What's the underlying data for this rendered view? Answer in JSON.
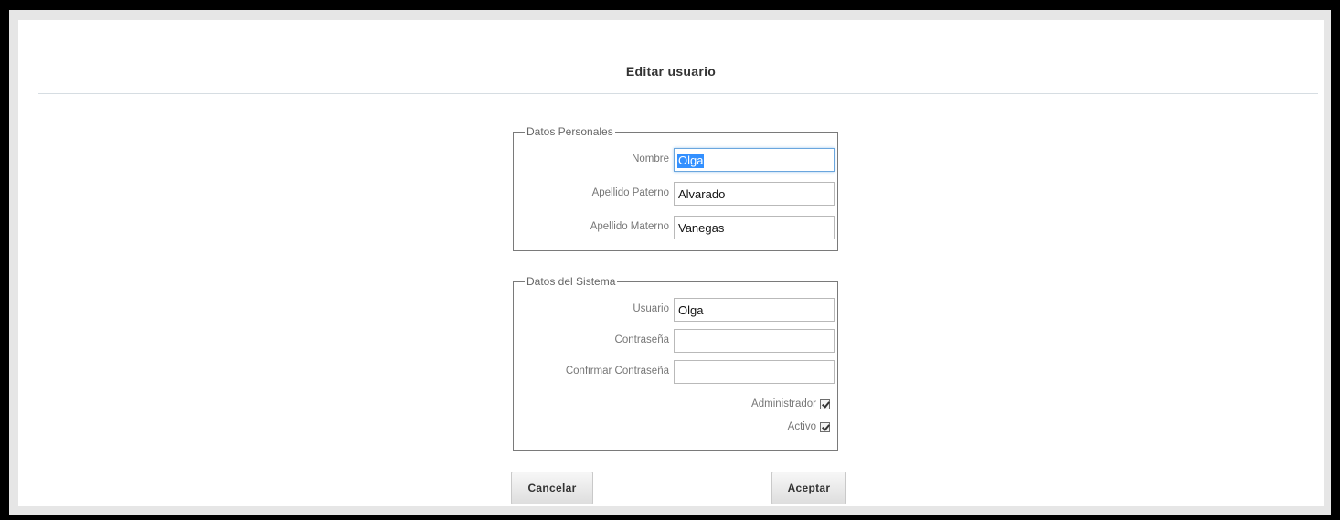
{
  "dialog": {
    "title": "Editar usuario"
  },
  "personal": {
    "legend": "Datos Personales",
    "nombre": {
      "label": "Nombre",
      "value": "Olga"
    },
    "apellido_paterno": {
      "label": "Apellido Paterno",
      "value": "Alvarado"
    },
    "apellido_materno": {
      "label": "Apellido Materno",
      "value": "Vanegas"
    }
  },
  "sistema": {
    "legend": "Datos del Sistema",
    "usuario": {
      "label": "Usuario",
      "value": "Olga"
    },
    "contrasena": {
      "label": "Contraseña",
      "value": ""
    },
    "confirmar": {
      "label": "Confirmar Contraseña",
      "value": ""
    },
    "administrador": {
      "label": "Administrador",
      "checked": true
    },
    "activo": {
      "label": "Activo",
      "checked": true
    }
  },
  "actions": {
    "cancel_label": "Cancelar",
    "ok_label": "Aceptar"
  },
  "colors": {
    "focus_border": "#6aa6de",
    "selection": "#3390ff"
  }
}
